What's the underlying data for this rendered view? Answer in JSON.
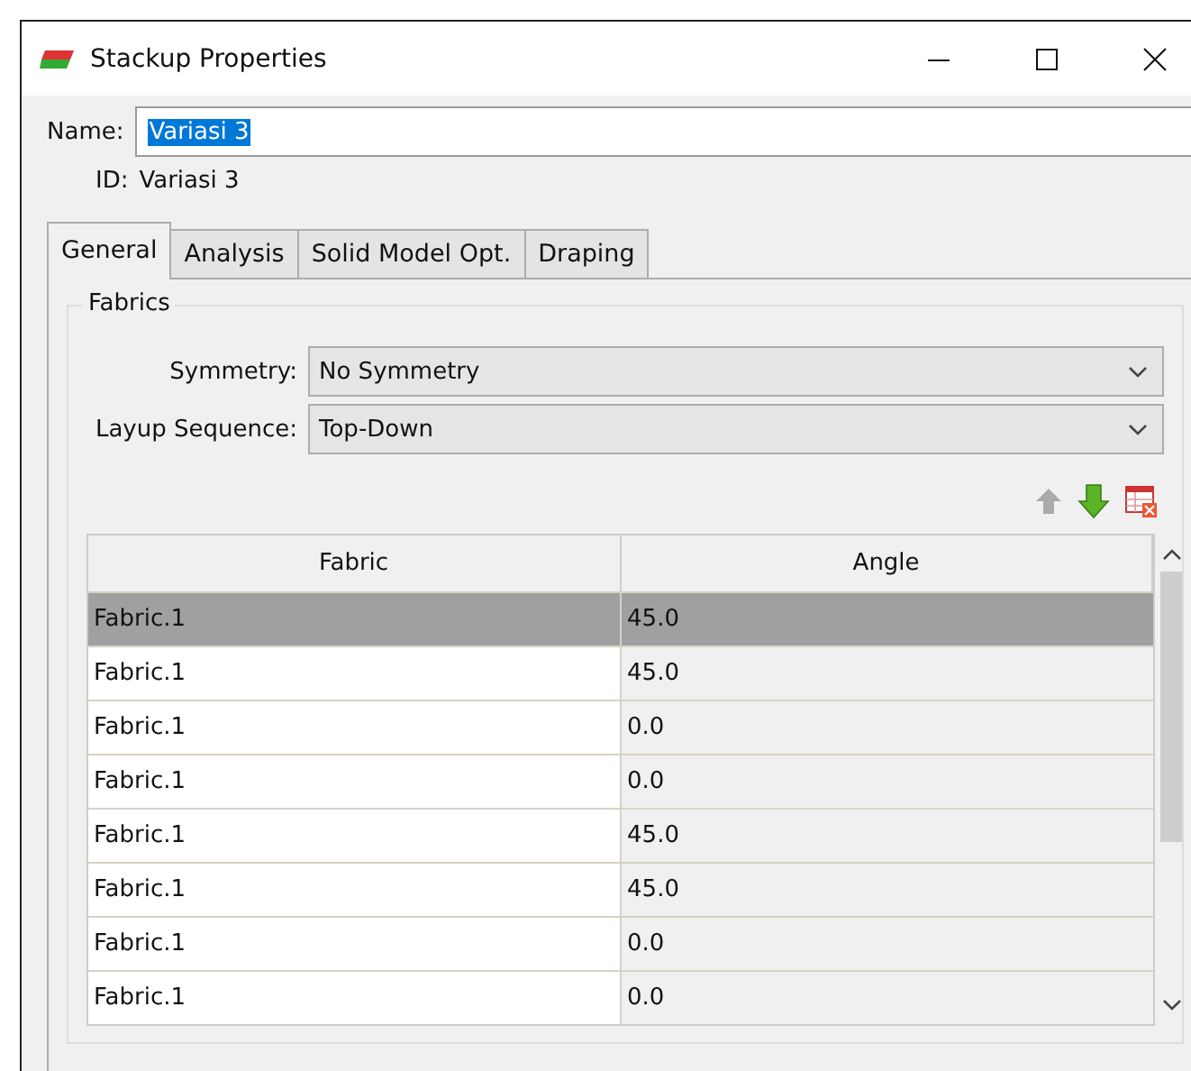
{
  "window": {
    "title": "Stackup Properties"
  },
  "name": {
    "label": "Name:",
    "value": "Variasi 3"
  },
  "id": {
    "label": "ID:",
    "value": "Variasi 3"
  },
  "tabs": [
    {
      "label": "General",
      "selected": true
    },
    {
      "label": "Analysis",
      "selected": false
    },
    {
      "label": "Solid Model Opt.",
      "selected": false
    },
    {
      "label": "Draping",
      "selected": false
    }
  ],
  "fabrics": {
    "title": "Fabrics",
    "fields": [
      {
        "label": "Symmetry:",
        "value": "No Symmetry"
      },
      {
        "label": "Layup Sequence:",
        "value": "Top-Down"
      }
    ],
    "toolbar": [
      {
        "kind": "up",
        "disabled": true
      },
      {
        "kind": "down",
        "disabled": false
      },
      {
        "kind": "delete",
        "disabled": false
      }
    ],
    "table": {
      "columns": [
        "Fabric",
        "Angle"
      ],
      "rows": [
        {
          "cells": [
            "Fabric.1",
            "45.0"
          ],
          "selected": true
        },
        {
          "cells": [
            "Fabric.1",
            "45.0"
          ],
          "selected": false
        },
        {
          "cells": [
            "Fabric.1",
            "0.0"
          ],
          "selected": false
        },
        {
          "cells": [
            "Fabric.1",
            "0.0"
          ],
          "selected": false
        },
        {
          "cells": [
            "Fabric.1",
            "45.0"
          ],
          "selected": false
        },
        {
          "cells": [
            "Fabric.1",
            "45.0"
          ],
          "selected": false
        },
        {
          "cells": [
            "Fabric.1",
            "0.0"
          ],
          "selected": false
        },
        {
          "cells": [
            "Fabric.1",
            "0.0"
          ],
          "selected": false
        }
      ]
    }
  }
}
